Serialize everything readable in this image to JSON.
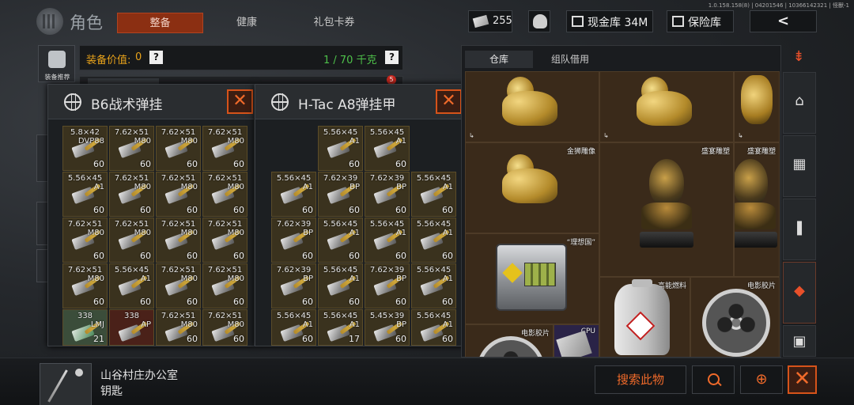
{
  "header": {
    "version_text": "1.0.158.158(8) | 04201546 | 10366142321 | 怪獸-1",
    "role_title": "角色",
    "tabs": [
      {
        "label": "整备",
        "active": true
      },
      {
        "label": "健康",
        "active": false
      },
      {
        "label": "礼包卡券",
        "active": false
      }
    ],
    "currency_value": "255",
    "cash_vault_label": "现金库 34M",
    "safe_box_label": "保险库",
    "back_glyph": "<"
  },
  "sidebar": {
    "recommend_label": "装备推荐"
  },
  "equipment": {
    "value_label": "装备价值:",
    "value": "0",
    "help_glyph": "?",
    "weight": "1 / 70 千克",
    "badge_count": "5"
  },
  "rig_window": {
    "title": "B6战术弹挂",
    "close_glyph": "✕",
    "cells": [
      {
        "cal": "5.8×42",
        "type": "DVP88",
        "qty": "60",
        "style": "normal"
      },
      {
        "cal": "7.62×51",
        "type": "M80",
        "qty": "60",
        "style": "normal"
      },
      {
        "cal": "7.62×51",
        "type": "M80",
        "qty": "60",
        "style": "normal"
      },
      {
        "cal": "7.62×51",
        "type": "M80",
        "qty": "60",
        "style": "normal"
      },
      {
        "cal": "5.56×45",
        "type": "A1",
        "qty": "60",
        "style": "normal"
      },
      {
        "cal": "7.62×51",
        "type": "M80",
        "qty": "60",
        "style": "normal"
      },
      {
        "cal": "7.62×51",
        "type": "M80",
        "qty": "60",
        "style": "normal"
      },
      {
        "cal": "7.62×51",
        "type": "M80",
        "qty": "60",
        "style": "normal"
      },
      {
        "cal": "7.62×51",
        "type": "M80",
        "qty": "60",
        "style": "normal"
      },
      {
        "cal": "7.62×51",
        "type": "M80",
        "qty": "60",
        "style": "normal"
      },
      {
        "cal": "7.62×51",
        "type": "M80",
        "qty": "60",
        "style": "normal"
      },
      {
        "cal": "7.62×51",
        "type": "M80",
        "qty": "60",
        "style": "normal"
      },
      {
        "cal": "7.62×51",
        "type": "M80",
        "qty": "60",
        "style": "normal"
      },
      {
        "cal": "5.56×45",
        "type": "A1",
        "qty": "60",
        "style": "normal"
      },
      {
        "cal": "7.62×51",
        "type": "M80",
        "qty": "60",
        "style": "normal"
      },
      {
        "cal": "7.62×51",
        "type": "M80",
        "qty": "60",
        "style": "normal"
      },
      {
        "cal": "338",
        "type": "LMJ",
        "qty": "21",
        "style": "med"
      },
      {
        "cal": "338",
        "type": "AP",
        "qty": "",
        "style": "red"
      },
      {
        "cal": "7.62×51",
        "type": "M80",
        "qty": "60",
        "style": "normal"
      },
      {
        "cal": "7.62×51",
        "type": "M80",
        "qty": "60",
        "style": "normal"
      }
    ]
  },
  "armor_window": {
    "title": "H-Tac A8弹挂甲",
    "close_glyph": "✕",
    "top_cells": [
      {
        "cal": "5.56×45",
        "type": "A1",
        "qty": "60",
        "style": "normal"
      },
      {
        "cal": "5.56×45",
        "type": "A1",
        "qty": "60",
        "style": "normal"
      }
    ],
    "cells": [
      {
        "cal": "5.56×45",
        "type": "A1",
        "qty": "60",
        "style": "normal"
      },
      {
        "cal": "7.62×39",
        "type": "BP",
        "qty": "60",
        "style": "normal"
      },
      {
        "cal": "7.62×39",
        "type": "BP",
        "qty": "60",
        "style": "normal"
      },
      {
        "cal": "5.56×45",
        "type": "A1",
        "qty": "60",
        "style": "normal"
      },
      {
        "cal": "7.62×39",
        "type": "BP",
        "qty": "60",
        "style": "normal"
      },
      {
        "cal": "5.56×45",
        "type": "A1",
        "qty": "60",
        "style": "normal"
      },
      {
        "cal": "5.56×45",
        "type": "A1",
        "qty": "60",
        "style": "normal"
      },
      {
        "cal": "5.56×45",
        "type": "A1",
        "qty": "60",
        "style": "normal"
      },
      {
        "cal": "7.62×39",
        "type": "BP",
        "qty": "60",
        "style": "normal"
      },
      {
        "cal": "5.56×45",
        "type": "A1",
        "qty": "60",
        "style": "normal"
      },
      {
        "cal": "7.62×39",
        "type": "BP",
        "qty": "60",
        "style": "normal"
      },
      {
        "cal": "5.56×45",
        "type": "A1",
        "qty": "60",
        "style": "normal"
      },
      {
        "cal": "5.56×45",
        "type": "A1",
        "qty": "60",
        "style": "normal"
      },
      {
        "cal": "5.56×45",
        "type": "A1",
        "qty": "17",
        "style": "normal"
      },
      {
        "cal": "5.45×39",
        "type": "BP",
        "qty": "60",
        "style": "normal"
      },
      {
        "cal": "5.56×45",
        "type": "A1",
        "qty": "60",
        "style": "normal"
      }
    ]
  },
  "warehouse": {
    "tabs": [
      {
        "label": "仓库",
        "active": true
      },
      {
        "label": "组队借用",
        "active": false
      }
    ],
    "items": {
      "lion_label": "金狮雕像",
      "bust_label": "盛宴雕塑",
      "case_label": "“理想国”",
      "fuel_label": "高能燃料",
      "reel_label": "电影胶片",
      "cpu_label": "CPU"
    }
  },
  "bottom": {
    "item_name": "山谷村庄办公室",
    "item_type": "钥匙",
    "search_button": "搜索此物",
    "cart_glyph": "⊕",
    "close_glyph": "✕"
  }
}
